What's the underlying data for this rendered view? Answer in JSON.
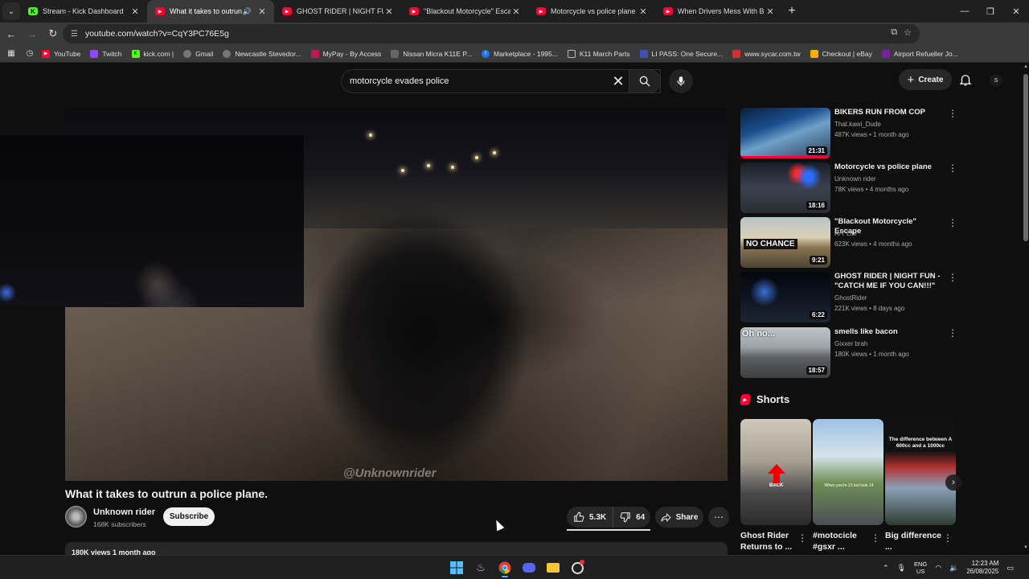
{
  "browser": {
    "tabs": [
      {
        "title": "Stream - Kick Dashboard",
        "icon": "kick-icon"
      },
      {
        "title": "What it takes to outrun a p",
        "icon": "youtube-icon",
        "active": true,
        "audio": true
      },
      {
        "title": "GHOST RIDER | NIGHT FUN - \"C",
        "icon": "youtube-icon"
      },
      {
        "title": "\"Blackout Motorcycle\" Escape -",
        "icon": "youtube-icon"
      },
      {
        "title": "Motorcycle vs police plane - Yo",
        "icon": "youtube-icon"
      },
      {
        "title": "When Drivers Mess With Bikers",
        "icon": "youtube-icon"
      }
    ],
    "new_tab": "+",
    "url": "youtube.com/watch?v=CqY3PC76E5g",
    "bookmarks": [
      {
        "label": "YouTube",
        "color": "#ff0033"
      },
      {
        "label": "Twitch",
        "color": "#9146ff"
      },
      {
        "label": "kick.com |",
        "color": "#53fc18"
      },
      {
        "label": "Gmail",
        "color": "#888888"
      },
      {
        "label": "Newcastle Stevedor...",
        "color": "#888888"
      },
      {
        "label": "MyPay - By Access",
        "color": "#c2185b"
      },
      {
        "label": "Nissan Micra K11E P...",
        "color": "#888888"
      },
      {
        "label": "Marketplace - 1995...",
        "color": "#1877f2"
      },
      {
        "label": "K11 March Parts",
        "color": "#666666"
      },
      {
        "label": "LI PASS: One Secure...",
        "color": "#3f51b5"
      },
      {
        "label": "www.sycar.com.tw",
        "color": "#d32f2f"
      },
      {
        "label": "Checkout | eBay",
        "color": "#f5af02"
      },
      {
        "label": "Airport Refueller Jo...",
        "color": "#7b1fa2"
      }
    ]
  },
  "youtube": {
    "search_query": "motorcycle evades police",
    "create_label": "Create",
    "avatar_letter": "S",
    "video": {
      "watermark": "@Unknownrider",
      "title": "What it takes to outrun a police plane.",
      "channel": "Unknown rider",
      "subscribers": "168K subscribers",
      "subscribe_label": "Subscribe",
      "likes": "5.3K",
      "dislikes": "64",
      "share_label": "Share",
      "description_meta": "180K views  1 month ago"
    },
    "recommendations": [
      {
        "title": "BIKERS RUN FROM COP",
        "channel": "That.kawi_Dude",
        "meta": "487K views • 1 month ago",
        "duration": "21:31",
        "watched_fraction": 1.0
      },
      {
        "title": "Motorcycle vs police plane",
        "channel": "Unknown rider",
        "meta": "78K views • 4 months ago",
        "duration": "18:16",
        "watched_fraction": 0
      },
      {
        "title": "\"Blackout Motorcycle\" Escape",
        "channel": "R/T Life",
        "meta": "623K views • 4 months ago",
        "duration": "9:21",
        "watched_fraction": 0,
        "thumb_text": "NO CHANCE"
      },
      {
        "title": "GHOST RIDER | NIGHT FUN - \"CATCH ME IF YOU CAN!!!\"",
        "channel": "GhostRider",
        "meta": "221K views • 8 days ago",
        "duration": "6:22",
        "watched_fraction": 0
      },
      {
        "title": "smells like bacon",
        "channel": "Gixxer brah",
        "meta": "180K views • 1 month ago",
        "duration": "18:57",
        "watched_fraction": 0,
        "thumb_text": "Oh no..."
      }
    ],
    "shorts_label": "Shorts",
    "shorts": [
      {
        "title": "Ghost Rider Returns to ...",
        "overlay": "BACK"
      },
      {
        "title": "#motocicle #gsxr ...",
        "overlay": "When you're 21 but look 14"
      },
      {
        "title": "Big difference ...",
        "overlay": "The difference between A 600cc and a 1000cc"
      }
    ]
  },
  "taskbar": {
    "language": "ENG",
    "region": "US",
    "time": "12:23 AM",
    "date": "26/08/2025"
  },
  "colors": {
    "youtube_red": "#ff0033",
    "background": "#0f0f0f",
    "chip": "#272727"
  }
}
